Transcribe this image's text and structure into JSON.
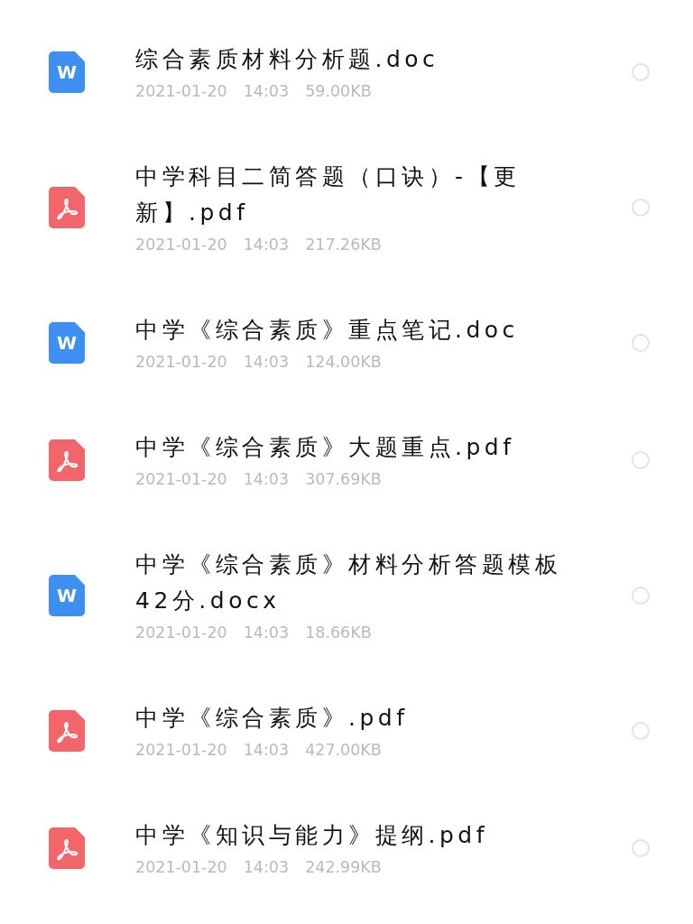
{
  "files": [
    {
      "kind": "word",
      "icon_label": "W",
      "name": "综合素质材料分析题.doc",
      "date": "2021-01-20",
      "time": "14:03",
      "size": "59.00KB",
      "selected": false
    },
    {
      "kind": "pdf",
      "name": "中学科目二简答题（口诀）-【更新】.pdf",
      "date": "2021-01-20",
      "time": "14:03",
      "size": "217.26KB",
      "selected": false
    },
    {
      "kind": "word",
      "icon_label": "W",
      "name": "中学《综合素质》重点笔记.doc",
      "date": "2021-01-20",
      "time": "14:03",
      "size": "124.00KB",
      "selected": false
    },
    {
      "kind": "pdf",
      "name": "中学《综合素质》大题重点.pdf",
      "date": "2021-01-20",
      "time": "14:03",
      "size": "307.69KB",
      "selected": false
    },
    {
      "kind": "word",
      "icon_label": "W",
      "name": "中学《综合素质》材料分析答题模板42分.docx",
      "date": "2021-01-20",
      "time": "14:03",
      "size": "18.66KB",
      "selected": false
    },
    {
      "kind": "pdf",
      "name": "中学《综合素质》.pdf",
      "date": "2021-01-20",
      "time": "14:03",
      "size": "427.00KB",
      "selected": false
    },
    {
      "kind": "pdf",
      "name": "中学《知识与能力》提纲.pdf",
      "date": "2021-01-20",
      "time": "14:03",
      "size": "242.99KB",
      "selected": false
    }
  ]
}
